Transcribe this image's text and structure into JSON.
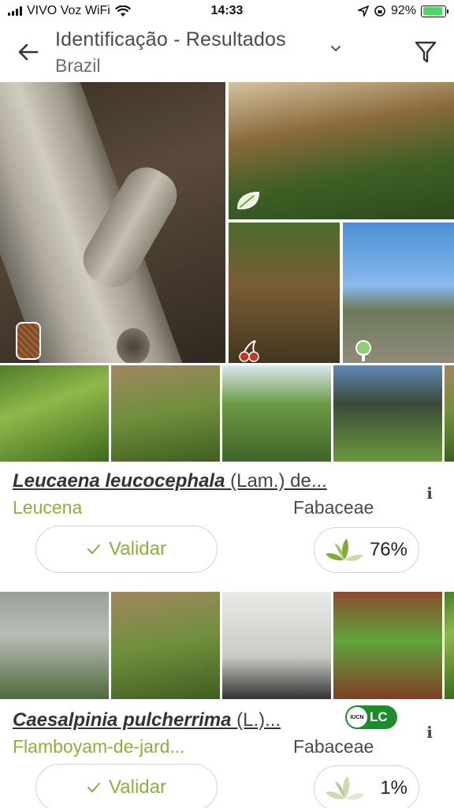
{
  "status_bar": {
    "carrier": "VIVO Voz WiFi",
    "time": "14:33",
    "battery": "92%",
    "battery_level": 0.92
  },
  "header": {
    "title": "Identificação - Resultados",
    "subtitle": "Brazil",
    "back_icon": "arrow-left-icon",
    "dropdown_icon": "chevron-down-icon",
    "filter_icon": "filter-icon"
  },
  "top_gallery": {
    "badges": [
      "bark-icon",
      "leaf-icon",
      "fruit-icon",
      "tree-icon"
    ]
  },
  "results": [
    {
      "genus_species": "Leucaena leucocephala",
      "author": " (Lam.) de...",
      "common_name": "Leucena",
      "family": "Fabaceae",
      "validate_label": "Validar",
      "score": "76%",
      "info_label": "i"
    },
    {
      "genus_species": "Caesalpinia pulcherrima",
      "author": " (L.)...",
      "common_name": "Flamboyam-de-jard...",
      "family": "Fabaceae",
      "validate_label": "Validar",
      "score": "1%",
      "info_label": "i",
      "iucn_org": "IUCN",
      "iucn_status": "LC"
    }
  ],
  "colors": {
    "accent_green": "#8db03a",
    "iucn_green": "#1e8c2c"
  }
}
